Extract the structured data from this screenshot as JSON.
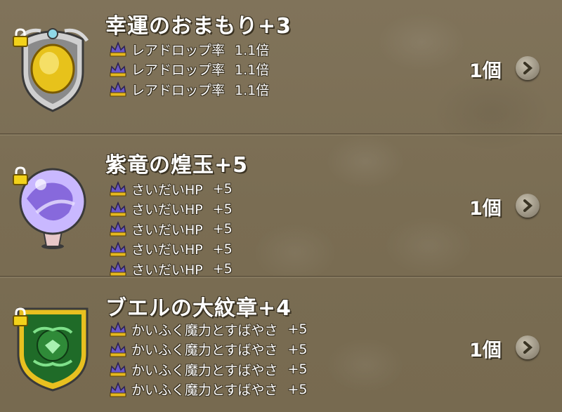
{
  "items": [
    {
      "name": "幸運のおまもり+3",
      "effects": [
        {
          "name": "レアドロップ率",
          "value": "1.1倍"
        },
        {
          "name": "レアドロップ率",
          "value": "1.1倍"
        },
        {
          "name": "レアドロップ率",
          "value": "1.1倍"
        }
      ],
      "quantity": "1個",
      "icon": "gold-amulet-icon"
    },
    {
      "name": "紫竜の煌玉+5",
      "effects": [
        {
          "name": "さいだいHP",
          "value": "+5"
        },
        {
          "name": "さいだいHP",
          "value": "+5"
        },
        {
          "name": "さいだいHP",
          "value": "+5"
        },
        {
          "name": "さいだいHP",
          "value": "+5"
        },
        {
          "name": "さいだいHP",
          "value": "+5"
        }
      ],
      "quantity": "1個",
      "icon": "purple-orb-icon"
    },
    {
      "name": "ブエルの大紋章+4",
      "effects": [
        {
          "name": "かいふく魔力とすばやさ",
          "value": "+5"
        },
        {
          "name": "かいふく魔力とすばやさ",
          "value": "+5"
        },
        {
          "name": "かいふく魔力とすばやさ",
          "value": "+5"
        },
        {
          "name": "かいふく魔力とすばやさ",
          "value": "+5"
        }
      ],
      "quantity": "1個",
      "icon": "green-crest-icon"
    }
  ],
  "colors": {
    "background": "#7a6d53",
    "text": "#ffffff",
    "text_outline": "#3a3222"
  }
}
